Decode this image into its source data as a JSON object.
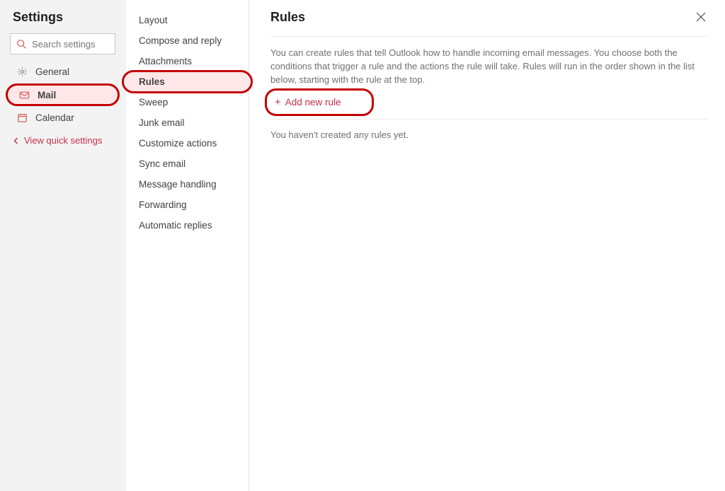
{
  "pane1": {
    "title": "Settings",
    "search_placeholder": "Search settings",
    "items": [
      {
        "label": "General"
      },
      {
        "label": "Mail"
      },
      {
        "label": "Calendar"
      }
    ],
    "view_quick": "View quick settings"
  },
  "pane2": {
    "items": [
      "Layout",
      "Compose and reply",
      "Attachments",
      "Rules",
      "Sweep",
      "Junk email",
      "Customize actions",
      "Sync email",
      "Message handling",
      "Forwarding",
      "Automatic replies"
    ]
  },
  "pane3": {
    "title": "Rules",
    "description": "You can create rules that tell Outlook how to handle incoming email messages. You choose both the conditions that trigger a rule and the actions the rule will take. Rules will run in the order shown in the list below, starting with the rule at the top.",
    "add_label": "Add new rule",
    "empty_text": "You haven't created any rules yet."
  }
}
